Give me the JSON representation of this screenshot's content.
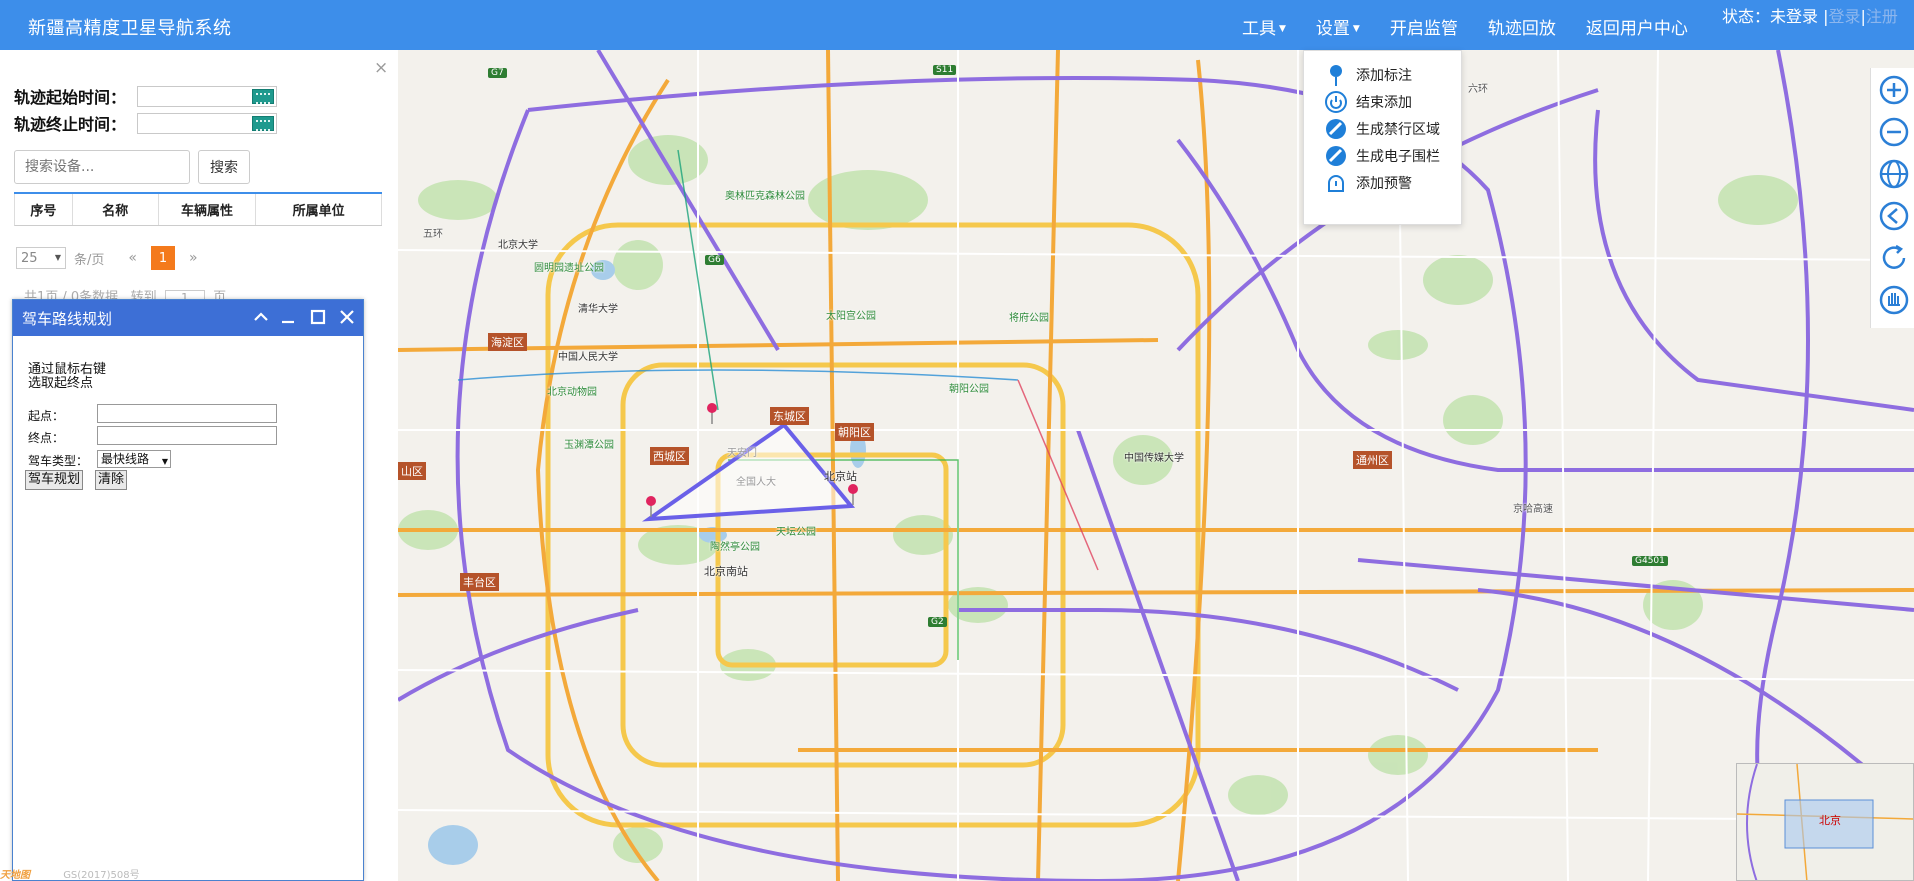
{
  "app": {
    "title": "新疆高精度卫星导航系统"
  },
  "nav": {
    "tools": "工具",
    "settings": "设置",
    "start_monitor": "开启监管",
    "track_playback": "轨迹回放",
    "back_user_center": "返回用户中心"
  },
  "status": {
    "label": "状态：",
    "value": "未登录",
    "sep": "|",
    "login": "登录",
    "sep2": "|",
    "register": "注册"
  },
  "left_panel": {
    "start_time_label": "轨迹起始时间：",
    "end_time_label": "轨迹终止时间：",
    "search_placeholder": "搜索设备...",
    "search_button": "搜索",
    "columns": [
      "序号",
      "名称",
      "车辆属性",
      "所属单位"
    ],
    "page_size": "25",
    "per_page_label": "条/页",
    "prev": "«",
    "current_page": "1",
    "next": "»",
    "page_info": "共1页 / 0条数据",
    "goto_label": "转到",
    "goto_value": "1",
    "page_unit": "页"
  },
  "route_dialog": {
    "title": "驾车路线规划",
    "hint_line1": "通过鼠标右键",
    "hint_line2": "选取起终点",
    "start_label": "起点：",
    "end_label": "终点：",
    "type_label": "驾车类型：",
    "type_value": "最快线路",
    "plan_button": "驾车规划",
    "clear_button": "清除"
  },
  "tool_menu": {
    "items": [
      "添加标注",
      "结束添加",
      "生成禁行区域",
      "生成电子围栏",
      "添加预警"
    ]
  },
  "footer": {
    "logo": "天地图",
    "code": "GS(2017)508号"
  },
  "map": {
    "labels": {
      "beijing_station": "北京站",
      "beijing_south": "北京南站",
      "tiananmen": "天安门",
      "renda": "全国人大",
      "dongcheng": "东城区",
      "xicheng": "西城区",
      "chaoyang": "朝阳区",
      "haidian": "海淀区",
      "fengtai": "丰台区",
      "tongzhou": "通州区",
      "shijingshan": "山区",
      "tiantan": "天坛公园",
      "taoranting": "陶然亭公园",
      "yuyuantan": "玉渊潭公园",
      "zoo": "北京动物园",
      "yuanmingyuan": "圆明园遗址公园",
      "chaoyang_park": "朝阳公园",
      "taiyanggong": "太阳宫公园",
      "jiangfu": "将府公园",
      "olympic": "奥林匹克森林公园",
      "guomao": "中国传媒大学",
      "pku_hosp": "北京大学",
      "tsinghua": "清华大学",
      "renmin": "中国人民大学",
      "overview_city": "北京",
      "g6": "G6",
      "g7": "G7",
      "g2": "G2",
      "s11": "S11",
      "g4501": "G4501",
      "wuhuan": "五环",
      "liuhuan": "六环",
      "jingha": "京哈高速"
    }
  },
  "colors": {
    "topbar": "#3d8eea",
    "dialog_title": "#3d6fd6",
    "polygon": "#5a4fe0",
    "pager_active": "#f47a1c"
  }
}
